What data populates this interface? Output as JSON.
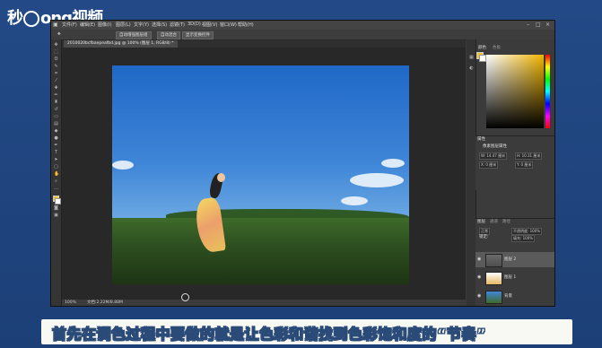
{
  "brand": {
    "logo_text_1": "秒",
    "logo_text_2": "ong视频"
  },
  "menubar": {
    "items": [
      "文件(F)",
      "编辑(E)",
      "图像(I)",
      "图层(L)",
      "文字(Y)",
      "选择(S)",
      "滤镜(T)",
      "3D(D)",
      "视图(V)",
      "窗口(W)",
      "帮助(H)"
    ]
  },
  "options": {
    "btn1": "自动增强图层组",
    "btn2": "自动混合",
    "btn3": "显示变换控件"
  },
  "document": {
    "tab_label": "2010020bcfbaepeafbd.jpg @ 100% (图层 1, RGB/8) *"
  },
  "status": {
    "zoom": "100%",
    "doc": "文档:2.22M/8.88M"
  },
  "panels": {
    "color_tab": "颜色",
    "swatch_tab": "色板",
    "props_title": "属性",
    "props_sub": "像素图层属性",
    "field_w": "W: 14.47 厘米",
    "field_h": "H: 10.31 厘米",
    "field_x": "X: 0 厘米",
    "field_y": "Y: 0 厘米",
    "layers_tab": "图层",
    "channels_tab": "通道",
    "paths_tab": "路径",
    "blend_mode": "正常",
    "opacity": "不透明度: 100%",
    "fill": "填充: 100%",
    "lock_label": "锁定:",
    "layer_items": [
      "图层 2",
      "图层 1",
      "背景"
    ]
  },
  "colors": {
    "foreground": "#f1c232",
    "background": "#ffffff"
  },
  "subtitle": {
    "text": "首先在调色过程中要做的就是让色彩和谐找到色彩饱和度的“节奏”"
  }
}
